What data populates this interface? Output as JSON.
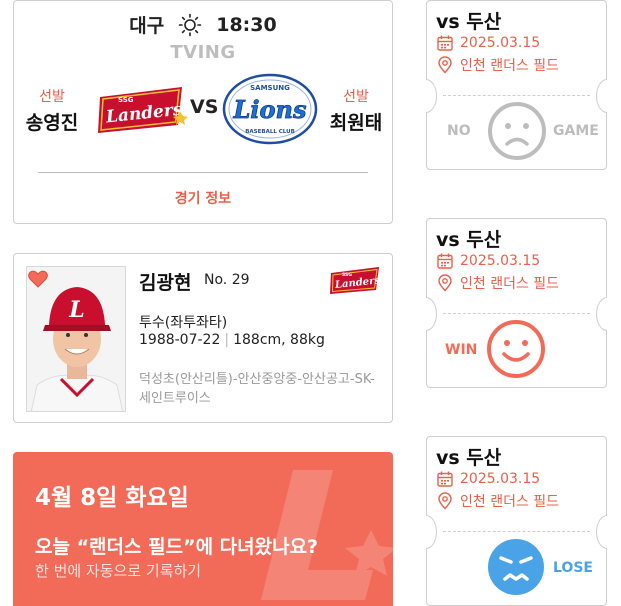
{
  "match": {
    "region": "대구",
    "weather_icon": "sun-icon",
    "time": "18:30",
    "broadcaster": "TVING",
    "home": {
      "starter_tag": "선발",
      "pitcher": "송영진",
      "logo_text": "Landers",
      "logo_small": "SSG"
    },
    "vs": "VS",
    "away": {
      "starter_tag": "선발",
      "pitcher": "최원태",
      "logo_text": "Lions",
      "logo_small": "SAMSUNG",
      "logo_sub": "BASEBALL CLUB"
    },
    "info_link": "경기 정보"
  },
  "player": {
    "name": "김광현",
    "number": "No. 29",
    "position": "투수(좌투좌타)",
    "birth": "1988-07-22",
    "body": "188cm, 88kg",
    "schools": "덕성초(안산리틀)-안산중앙중-안산공고-SK-세인트루이스",
    "favorite_icon": "heart-icon",
    "team_logo_text": "Landers",
    "team_logo_small": "SSG"
  },
  "banner": {
    "date": "4월 8일 화요일",
    "question": "오늘 “랜더스 필드”에 다녀왔나요?",
    "subtitle": "한 번에 자동으로 기록하기"
  },
  "tickets": [
    {
      "opponent": "vs 두산",
      "date": "2025.03.15",
      "place": "인천 랜더스 필드",
      "left_word": "NO",
      "right_word": "GAME",
      "result": "none",
      "face": "neutral-face-icon",
      "color": "#bdbdbd"
    },
    {
      "opponent": "vs 두산",
      "date": "2025.03.15",
      "place": "인천 랜더스 필드",
      "left_word": "WIN",
      "right_word": "",
      "result": "win",
      "face": "happy-face-icon",
      "color": "#f26a58"
    },
    {
      "opponent": "vs 두산",
      "date": "2025.03.15",
      "place": "인천 랜더스 필드",
      "left_word": "",
      "right_word": "LOSE",
      "result": "lose",
      "face": "angry-face-icon",
      "color": "#4aa3e6"
    }
  ],
  "colors": {
    "accent": "#f26a58",
    "text_red": "#e8604a",
    "lose_blue": "#4aa3e6",
    "muted": "#bdbdbd"
  }
}
